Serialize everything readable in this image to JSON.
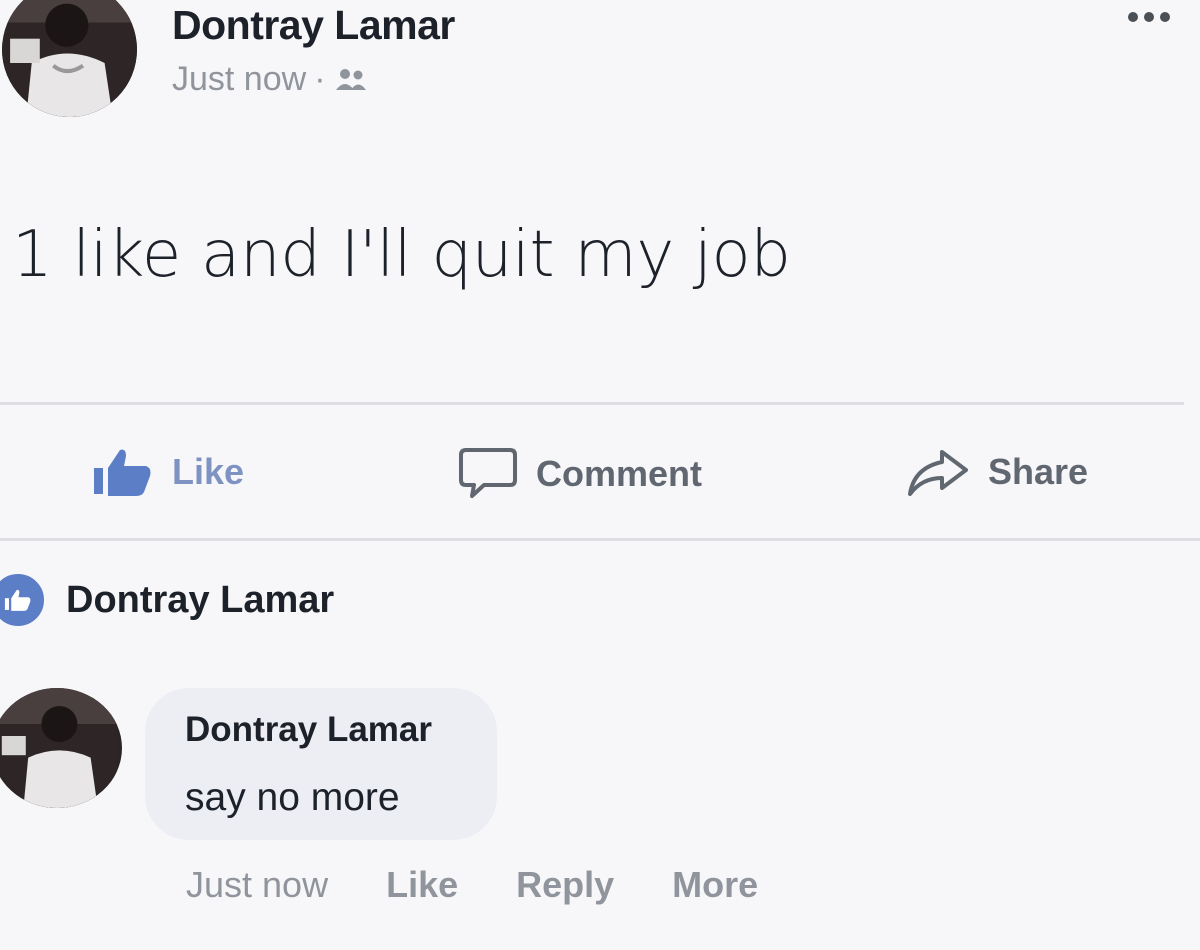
{
  "post": {
    "author": "Dontray Lamar",
    "timestamp": "Just now",
    "separator": "·",
    "audience_icon": "friends-icon",
    "text": "1 like and I'll quit my job"
  },
  "actions": {
    "like": "Like",
    "comment": "Comment",
    "share": "Share"
  },
  "reactions": {
    "icon": "like-badge-icon",
    "name": "Dontray Lamar"
  },
  "comment": {
    "author": "Dontray Lamar",
    "text": "say no more",
    "timestamp": "Just now",
    "like": "Like",
    "reply": "Reply",
    "more": "More"
  },
  "colors": {
    "like_blue": "#5b7ec6",
    "text_dark": "#1d2129",
    "text_gray": "#90949c"
  }
}
